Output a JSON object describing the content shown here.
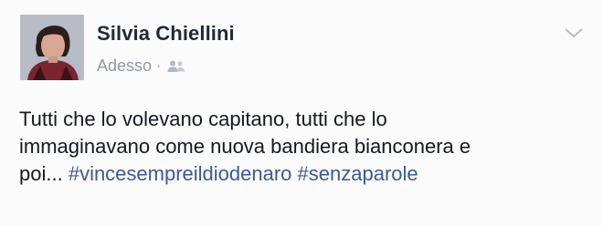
{
  "post": {
    "author_name": "Silvia Chiellini",
    "timestamp": "Adesso",
    "separator": "·",
    "audience_icon": "friends-icon",
    "menu_icon": "chevron-down-icon",
    "text_line1": "Tutti che lo volevano capitano, tutti che lo",
    "text_line2": "immaginavano come nuova bandiera bianconera e",
    "text_line3_start": "poi...",
    "hashtags": [
      "#vincesempreildiodenaro",
      "#senzaparole"
    ]
  },
  "colors": {
    "author": "#232937",
    "meta": "#9197a3",
    "text": "#141823",
    "hashtag": "#3b5998"
  }
}
